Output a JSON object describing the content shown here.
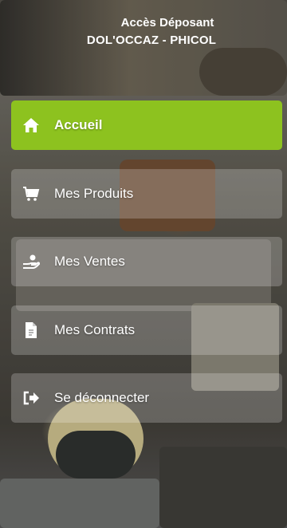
{
  "header": {
    "title": "Accès Déposant",
    "subtitle": "DOL'OCCAZ - PHICOL"
  },
  "menu": {
    "items": [
      {
        "label": "Accueil",
        "icon": "home-icon",
        "active": true
      },
      {
        "label": "Mes Produits",
        "icon": "cart-icon",
        "active": false
      },
      {
        "label": "Mes Ventes",
        "icon": "hand-money-icon",
        "active": false
      },
      {
        "label": "Mes Contrats",
        "icon": "document-icon",
        "active": false
      },
      {
        "label": "Se déconnecter",
        "icon": "logout-icon",
        "active": false
      }
    ]
  },
  "colors": {
    "accent": "#8dc21f",
    "text": "#ffffff"
  }
}
